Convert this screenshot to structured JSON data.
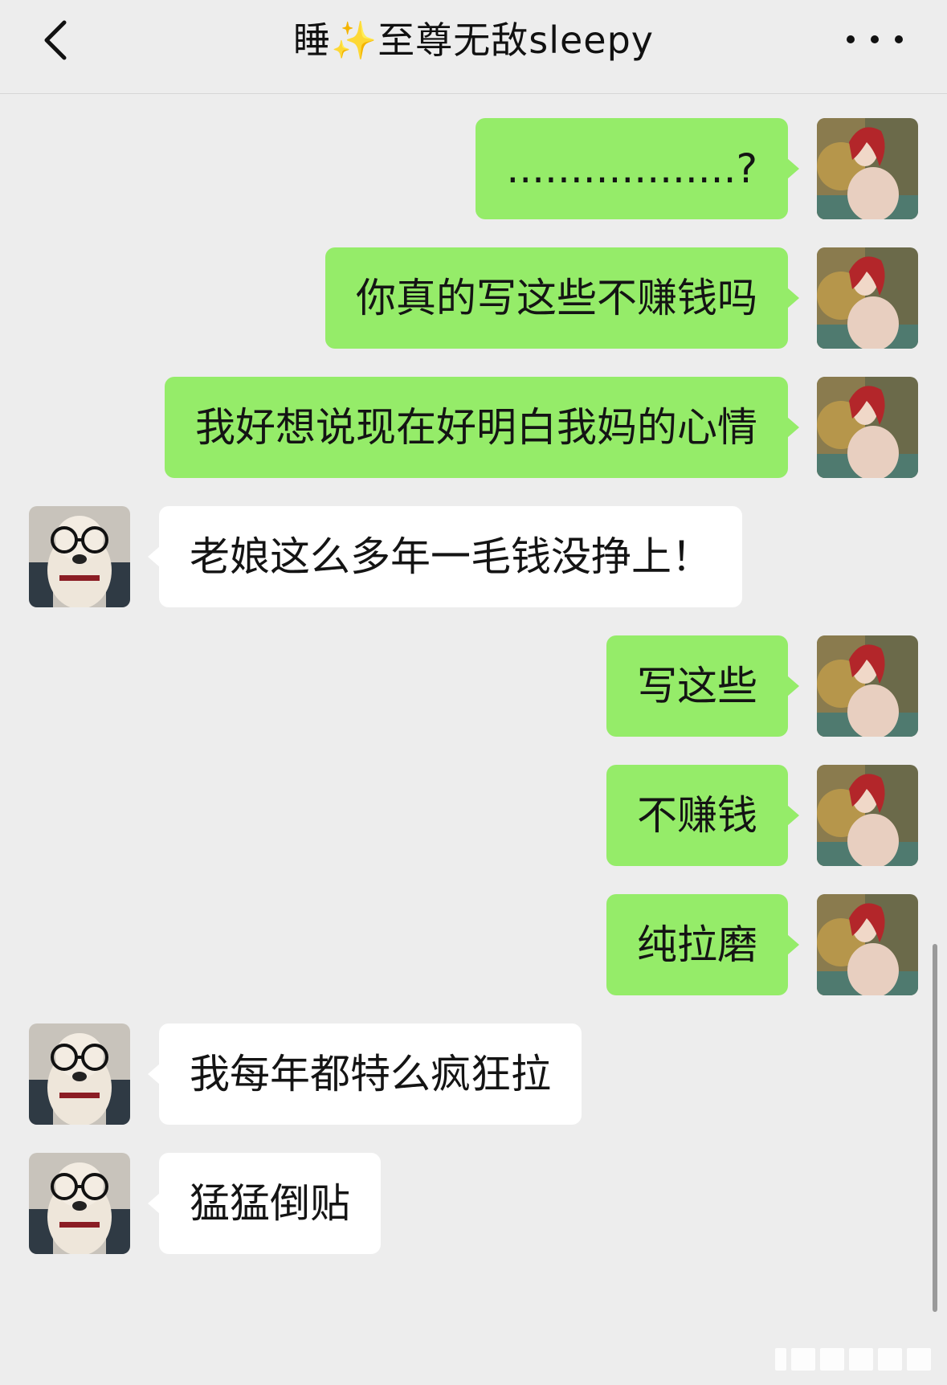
{
  "header": {
    "title": "睡✨至尊无敌sleepy"
  },
  "messages": [
    {
      "from": "me",
      "text": "..................?"
    },
    {
      "from": "me",
      "text": "你真的写这些不赚钱吗"
    },
    {
      "from": "me",
      "text": "我好想说现在好明白我妈的心情"
    },
    {
      "from": "other",
      "text": "老娘这么多年一毛钱没挣上！"
    },
    {
      "from": "me",
      "text": "写这些"
    },
    {
      "from": "me",
      "text": "不赚钱"
    },
    {
      "from": "me",
      "text": "纯拉磨"
    },
    {
      "from": "other",
      "text": "我每年都特么疯狂拉"
    },
    {
      "from": "other",
      "text": "猛猛倒贴"
    }
  ],
  "colors": {
    "background": "#ededed",
    "my_bubble": "#95ec69",
    "other_bubble": "#ffffff"
  },
  "icons": {
    "back": "chevron-left-icon",
    "more": "more-dots-icon"
  }
}
